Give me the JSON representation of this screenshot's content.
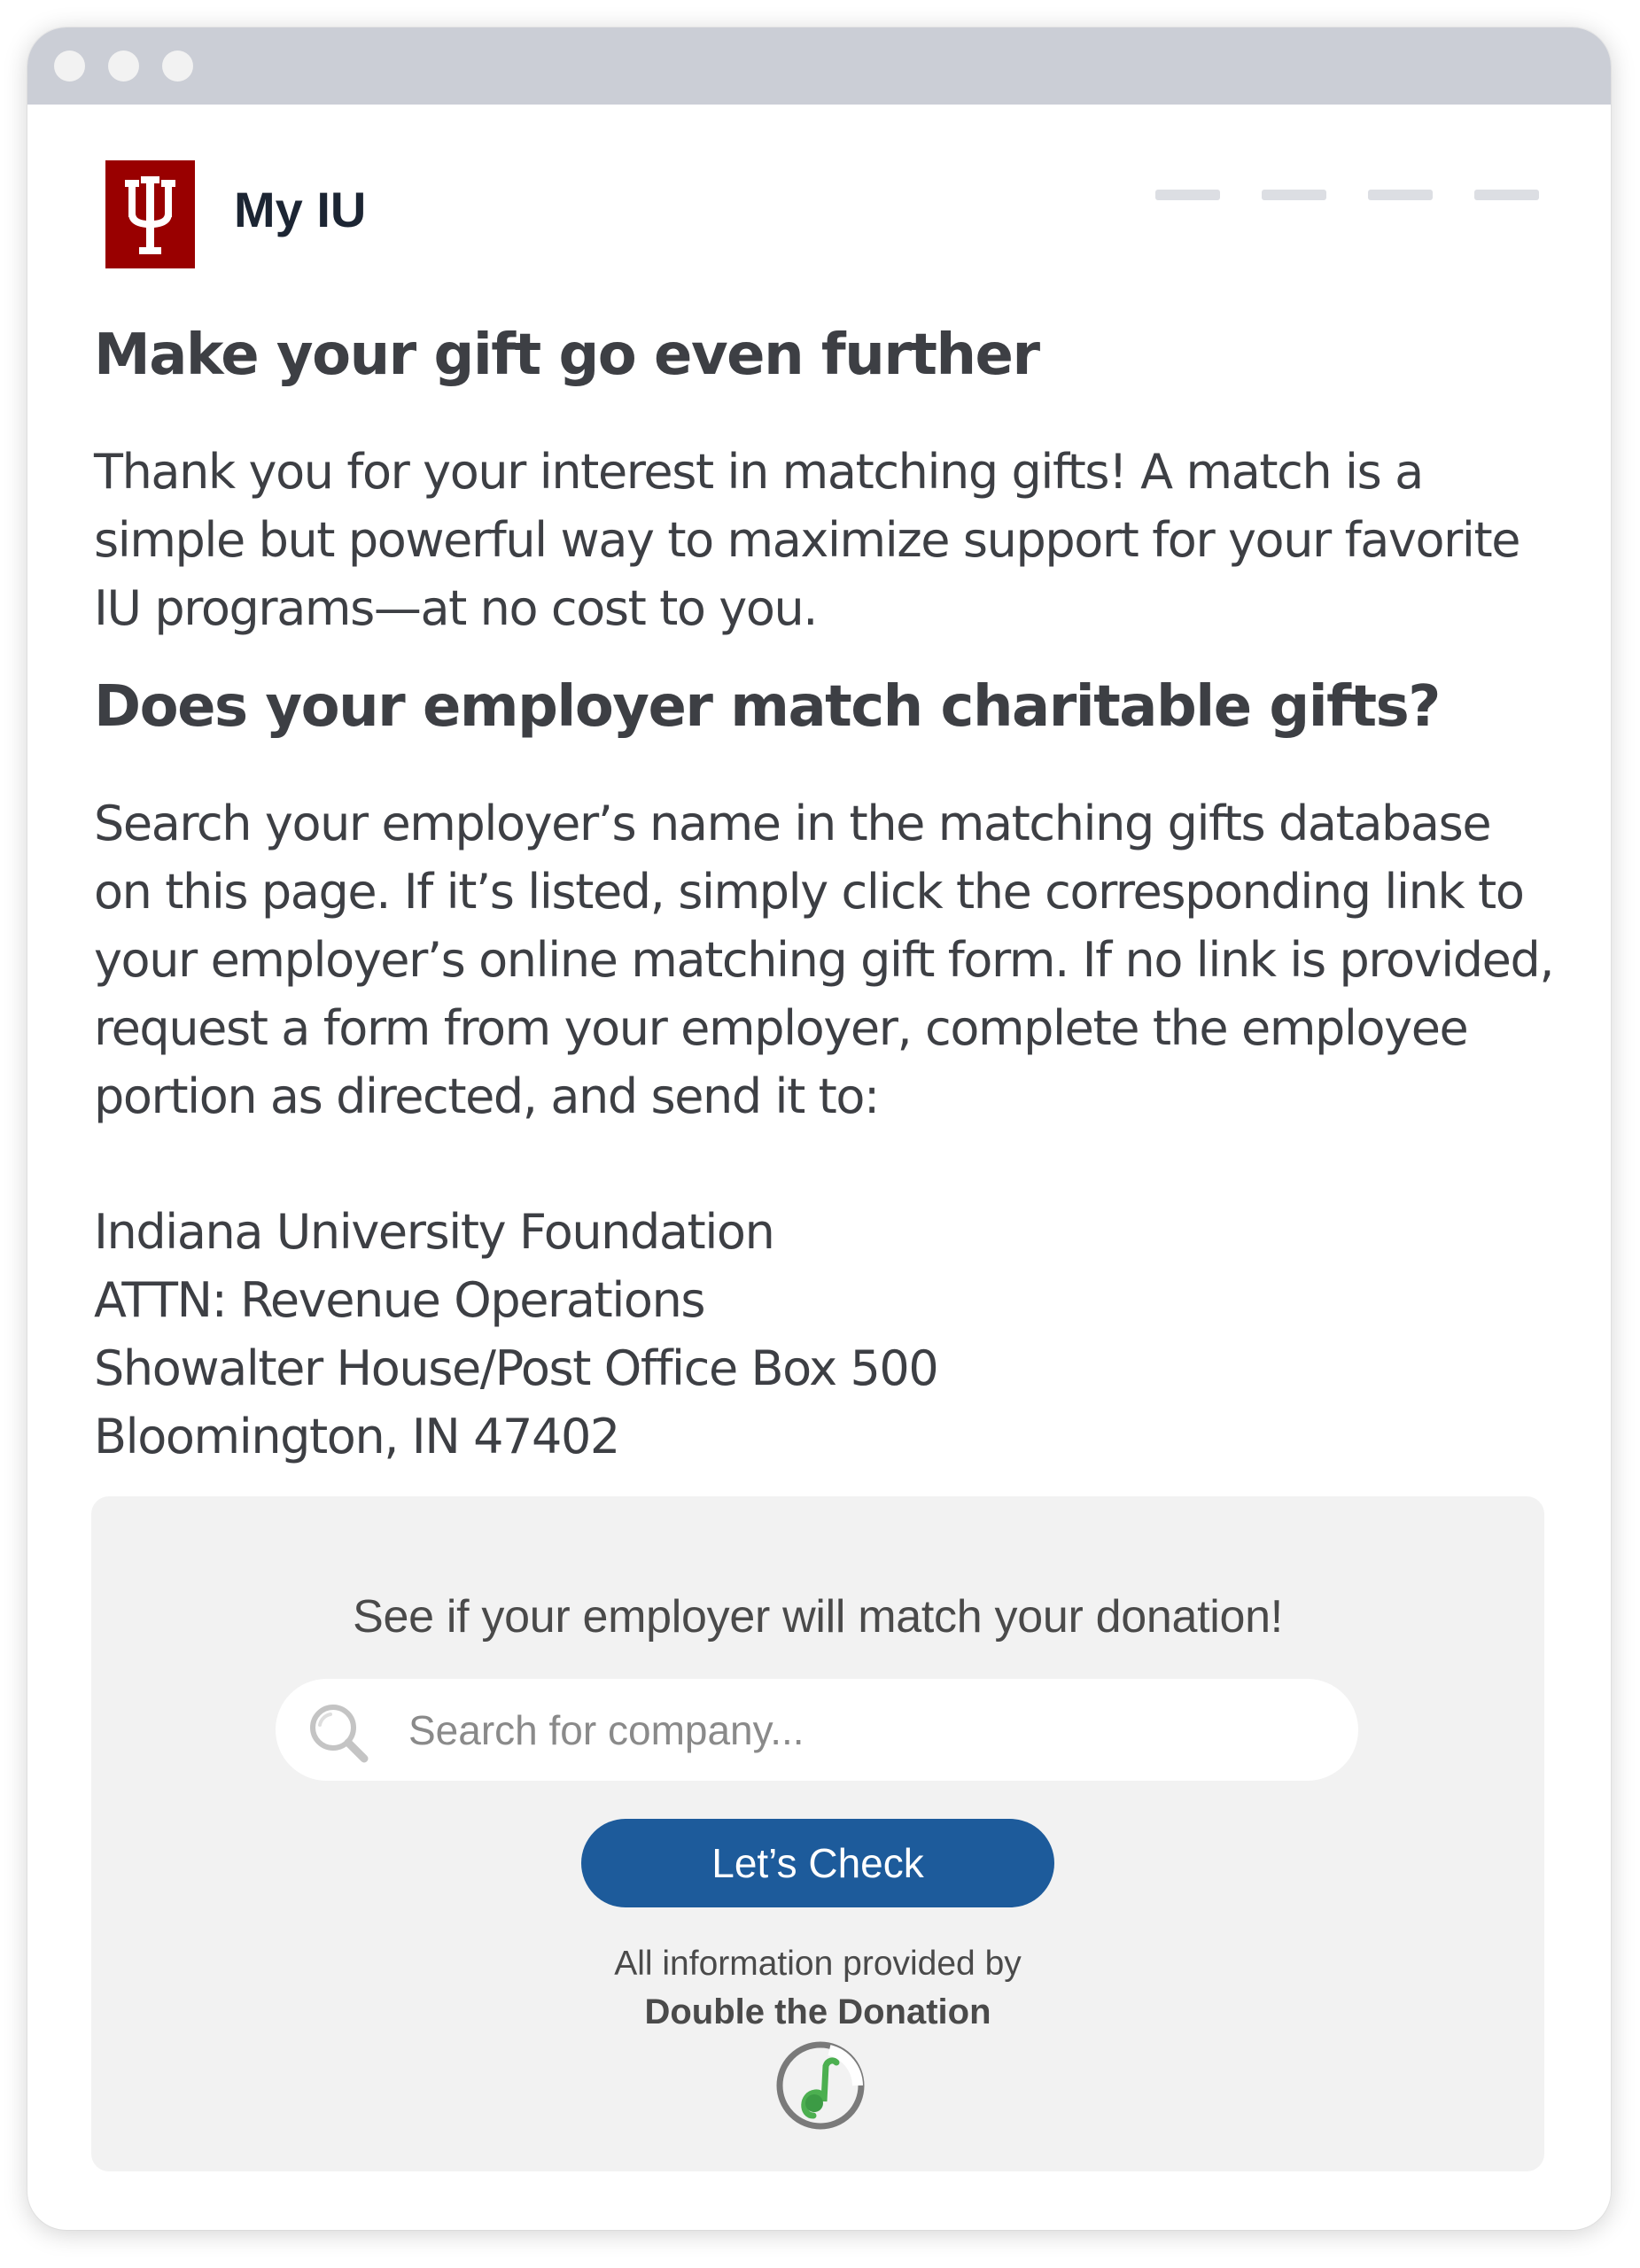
{
  "window": {
    "controls": [
      "close",
      "minimize",
      "maximize"
    ]
  },
  "header": {
    "logo_icon": "iu-trident-logo",
    "brand": "My IU",
    "nav_item_count_label": "",
    "colors": {
      "brand_crimson": "#990000"
    }
  },
  "content": {
    "heading_1": "Make your gift go even further",
    "intro_lines": [
      "Thank you for your interest in matching gifts! A match is a",
      "simple but powerful way to maximize support for your favorite",
      "IU programs—at no cost to you."
    ],
    "heading_2": "Does your employer match charitable gifts?",
    "instructions_lines": [
      "Search your employer’s name in the matching gifts database",
      "on this page. If it’s listed, simply click the corresponding link to",
      "your employer’s online matching gift form. If no link is provided,",
      "request a form from your employer, complete the employee",
      "portion as directed, and send it to:"
    ],
    "address_lines": [
      "Indiana University Foundation",
      "ATTN: Revenue Operations",
      "Showalter House/Post Office Box 500",
      "Bloomington, IN 47402"
    ]
  },
  "widget": {
    "title": "See if your employer will match your donation!",
    "search": {
      "placeholder": "Search for company...",
      "value": "",
      "icon": "search-icon"
    },
    "button_label": "Let’s Check",
    "provided_by": "All information provided by",
    "provider_name": "Double the Donation",
    "provider_icon": "double-the-donation-logo",
    "colors": {
      "button": "#1d5b9b",
      "panel": "#f2f2f2"
    }
  }
}
